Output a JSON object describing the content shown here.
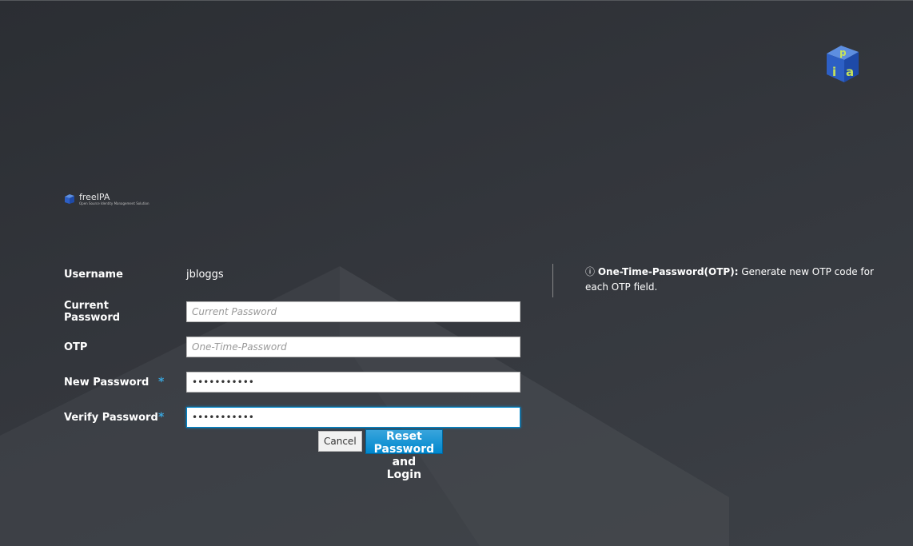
{
  "brand": {
    "name": "freeIPA",
    "tagline": "Open Source Identity Management Solution"
  },
  "form": {
    "username_label": "Username",
    "username_value": "jbloggs",
    "current_password_label": "Current Password",
    "current_password_placeholder": "Current Password",
    "otp_label": "OTP",
    "otp_placeholder": "One-Time-Password",
    "new_password_label": "New Password",
    "new_password_value": "•••••••••••",
    "verify_password_label": "Verify Password",
    "verify_password_value": "•••••••••••",
    "required_marker": "*",
    "cancel_label": "Cancel",
    "reset_label": "Reset Password and Login"
  },
  "info": {
    "icon": "info-circle-icon",
    "title": "One-Time-Password(OTP):",
    "text": " Generate new OTP code for each OTP field."
  },
  "colors": {
    "accent": "#0088ce",
    "required": "#39a5dc"
  }
}
